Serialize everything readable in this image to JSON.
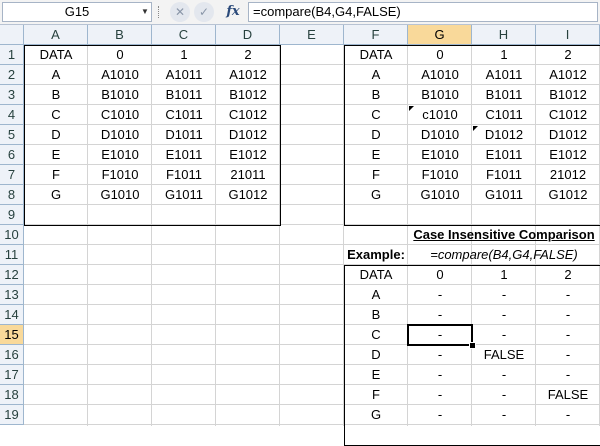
{
  "name_box": "G15",
  "formula": "=compare(B4,G4,FALSE)",
  "icons": {
    "namebox_arrow": "chevron-down-icon",
    "cancel": "close-icon",
    "enter": "check-icon",
    "function": "fx-icon"
  },
  "fx_label": "fx",
  "columns": [
    "A",
    "B",
    "C",
    "D",
    "E",
    "F",
    "G",
    "H",
    "I"
  ],
  "rows": [
    "1",
    "2",
    "3",
    "4",
    "5",
    "6",
    "7",
    "8",
    "9",
    "10",
    "11",
    "12",
    "13",
    "14",
    "15",
    "16",
    "17",
    "18",
    "19"
  ],
  "left_table": {
    "headers": [
      "DATA",
      "0",
      "1",
      "2"
    ],
    "rows": [
      [
        "A",
        "A1010",
        "A1011",
        "A1012"
      ],
      [
        "B",
        "B1010",
        "B1011",
        "B1012"
      ],
      [
        "C",
        "C1010",
        "C1011",
        "C1012"
      ],
      [
        "D",
        "D1010",
        "D1011",
        "D1012"
      ],
      [
        "E",
        "E1010",
        "E1011",
        "E1012"
      ],
      [
        "F",
        "F1010",
        "F1011",
        "21011"
      ],
      [
        "G",
        "G1010",
        "G1011",
        "G1012"
      ]
    ]
  },
  "right_table": {
    "headers": [
      "DATA",
      "0",
      "1",
      "2"
    ],
    "rows": [
      [
        "A",
        "A1010",
        "A1011",
        "A1012"
      ],
      [
        "B",
        "B1010",
        "B1011",
        "B1012"
      ],
      [
        "C",
        "c1010",
        "C1011",
        "C1012"
      ],
      [
        "D",
        "D1010",
        "D1012",
        "D1012"
      ],
      [
        "E",
        "E1010",
        "E1011",
        "E1012"
      ],
      [
        "F",
        "F1010",
        "F1011",
        "21012"
      ],
      [
        "G",
        "G1010",
        "G1011",
        "G1012"
      ]
    ]
  },
  "comparison": {
    "title": "Case Insensitive Comparison",
    "example_label": "Example:",
    "example_formula": "=compare(B4,G4,FALSE)",
    "headers": [
      "DATA",
      "0",
      "1",
      "2"
    ],
    "rows": [
      [
        "A",
        "-",
        "-",
        "-"
      ],
      [
        "B",
        "-",
        "-",
        "-"
      ],
      [
        "C",
        "-",
        "-",
        "-"
      ],
      [
        "D",
        "-",
        "FALSE",
        "-"
      ],
      [
        "E",
        "-",
        "-",
        "-"
      ],
      [
        "F",
        "-",
        "-",
        "FALSE"
      ],
      [
        "G",
        "-",
        "-",
        "-"
      ]
    ]
  }
}
